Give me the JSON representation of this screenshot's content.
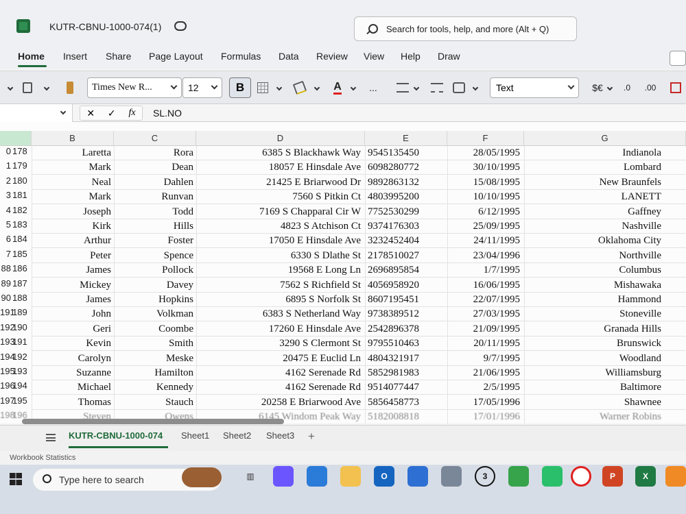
{
  "window": {
    "title": "KUTR-CBNU-1000-074(1)",
    "search_placeholder": "Search for tools, help, and more (Alt + Q)"
  },
  "menu": {
    "items": [
      "Home",
      "Insert",
      "Share",
      "Page Layout",
      "Formulas",
      "Data",
      "Review",
      "View",
      "Help",
      "Draw"
    ]
  },
  "toolbar": {
    "font_name": "Times New R...",
    "font_size": "12",
    "bold": "B",
    "number_format": "Text",
    "ellipsis": "...",
    "currency": "$€",
    "decimal_decrease": ".0",
    "decimal_increase": ".00"
  },
  "formula_bar": {
    "cancel": "✕",
    "enter": "✓",
    "fx": "fx",
    "content": "SL.NO"
  },
  "columns": [
    "B",
    "C",
    "D",
    "E",
    "F",
    "G"
  ],
  "rows": [
    {
      "left": "0",
      "right": "178",
      "b": "Laretta",
      "c": "Rora",
      "d": "6385 S Blackhawk Way",
      "e": "9545135450",
      "f": "28/05/1995",
      "g": "Indianola"
    },
    {
      "left": "1",
      "right": "179",
      "b": "Mark",
      "c": "Dean",
      "d": "18057 E Hinsdale Ave",
      "e": "6098280772",
      "f": "30/10/1995",
      "g": "Lombard"
    },
    {
      "left": "2",
      "right": "180",
      "b": "Neal",
      "c": "Dahlen",
      "d": "21425 E Briarwood Dr",
      "e": "9892863132",
      "f": "15/08/1995",
      "g": "New Braunfels"
    },
    {
      "left": "3",
      "right": "181",
      "b": "Mark",
      "c": "Runvan",
      "d": "7560 S Pitkin Ct",
      "e": "4803995200",
      "f": "10/10/1995",
      "g": "LANETT"
    },
    {
      "left": "4",
      "right": "182",
      "b": "Joseph",
      "c": "Todd",
      "d": "7169 S Chapparal Cir W",
      "e": "7752530299",
      "f": "6/12/1995",
      "g": "Gaffney"
    },
    {
      "left": "5",
      "right": "183",
      "b": "Kirk",
      "c": "Hills",
      "d": "4823 S Atchison Ct",
      "e": "9374176303",
      "f": "25/09/1995",
      "g": "Nashville"
    },
    {
      "left": "6",
      "right": "184",
      "b": "Arthur",
      "c": "Foster",
      "d": "17050 E Hinsdale Ave",
      "e": "3232452404",
      "f": "24/11/1995",
      "g": "Oklahoma City"
    },
    {
      "left": "7",
      "right": "185",
      "b": "Peter",
      "c": "Spence",
      "d": "6330 S Dlathe St",
      "e": "2178510027",
      "f": "23/04/1996",
      "g": "Northville"
    },
    {
      "left": "88",
      "right": "186",
      "b": "James",
      "c": "Pollock",
      "d": "19568 E Long Ln",
      "e": "2696895854",
      "f": "1/7/1995",
      "g": "Columbus"
    },
    {
      "left": "89",
      "right": "187",
      "b": "Mickey",
      "c": "Davey",
      "d": "7562 S Richfield St",
      "e": "4056958920",
      "f": "16/06/1995",
      "g": "Mishawaka"
    },
    {
      "left": "90",
      "right": "188",
      "b": "James",
      "c": "Hopkins",
      "d": "6895 S Norfolk St",
      "e": "8607195451",
      "f": "22/07/1995",
      "g": "Hammond"
    },
    {
      "left": "191",
      "right": "189",
      "b": "John",
      "c": "Volkman",
      "d": "6383 S Netherland Way",
      "e": "9738389512",
      "f": "27/03/1995",
      "g": "Stoneville"
    },
    {
      "left": "192",
      "right": "190",
      "b": "Geri",
      "c": "Coombe",
      "d": "17260 E Hinsdale Ave",
      "e": "2542896378",
      "f": "21/09/1995",
      "g": "Granada Hills"
    },
    {
      "left": "193",
      "right": "191",
      "b": "Kevin",
      "c": "Smith",
      "d": "3290 S Clermont St",
      "e": "9795510463",
      "f": "20/11/1995",
      "g": "Brunswick"
    },
    {
      "left": "194",
      "right": "192",
      "b": "Carolyn",
      "c": "Meske",
      "d": "20475 E Euclid Ln",
      "e": "4804321917",
      "f": "9/7/1995",
      "g": "Woodland"
    },
    {
      "left": "195",
      "right": "193",
      "b": "Suzanne",
      "c": "Hamilton",
      "d": "4162 Serenade Rd",
      "e": "5852981983",
      "f": "21/06/1995",
      "g": "Williamsburg"
    },
    {
      "left": "196",
      "right": "194",
      "b": "Michael",
      "c": "Kennedy",
      "d": "4162 Serenade Rd",
      "e": "9514077447",
      "f": "2/5/1995",
      "g": "Baltimore"
    },
    {
      "left": "197",
      "right": "195",
      "b": "Thomas",
      "c": "Stauch",
      "d": "20258 E Briarwood Ave",
      "e": "5856458773",
      "f": "17/05/1996",
      "g": "Shawnee"
    },
    {
      "left": "198",
      "right": "196",
      "b": "Steven",
      "c": "Owens",
      "d": "6145 Windom Peak Way",
      "e": "5182008818",
      "f": "17/01/1996",
      "g": "Warner Robins"
    }
  ],
  "sheets": [
    "KUTR-CBNU-1000-074",
    "Sheet1",
    "Sheet2",
    "Sheet3"
  ],
  "add_sheet": "+",
  "status": {
    "text": "Workbook Statistics"
  },
  "taskbar": {
    "search_placeholder": "Type here to search",
    "whatsapp_badge": "3"
  }
}
